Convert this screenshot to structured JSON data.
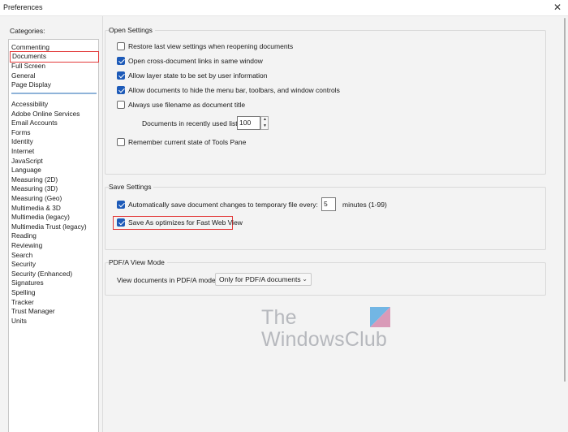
{
  "window": {
    "title": "Preferences",
    "close_glyph": "✕"
  },
  "categories": {
    "label": "Categories:",
    "top": [
      "Commenting",
      "Documents",
      "Full Screen",
      "General",
      "Page Display"
    ],
    "bottom": [
      "Accessibility",
      "Adobe Online Services",
      "Email Accounts",
      "Forms",
      "Identity",
      "Internet",
      "JavaScript",
      "Language",
      "Measuring (2D)",
      "Measuring (3D)",
      "Measuring (Geo)",
      "Multimedia & 3D",
      "Multimedia (legacy)",
      "Multimedia Trust (legacy)",
      "Reading",
      "Reviewing",
      "Search",
      "Security",
      "Security (Enhanced)",
      "Signatures",
      "Spelling",
      "Tracker",
      "Trust Manager",
      "Units"
    ],
    "selected": "Documents"
  },
  "open_settings": {
    "title": "Open Settings",
    "restore_last_view": {
      "label": "Restore last view settings when reopening documents",
      "checked": false
    },
    "cross_doc_links": {
      "label": "Open cross-document links in same window",
      "checked": true
    },
    "layer_state": {
      "label": "Allow layer state to be set by user information",
      "checked": true
    },
    "hide_menu_bar": {
      "label": "Allow documents to hide the menu bar, toolbars, and window controls",
      "checked": true
    },
    "filename_title": {
      "label": "Always use filename as document title",
      "checked": false
    },
    "recent_list": {
      "label": "Documents in recently used list:",
      "value": "100"
    },
    "remember_tools_pane": {
      "label": "Remember current state of Tools Pane",
      "checked": false
    }
  },
  "save_settings": {
    "title": "Save Settings",
    "autosave": {
      "label": "Automatically save document changes to temporary file every:",
      "checked": true,
      "value": "5",
      "unit": "minutes (1-99)"
    },
    "fast_web_view": {
      "label": "Save As optimizes for Fast Web View",
      "checked": true
    }
  },
  "pdfa": {
    "title": "PDF/A View Mode",
    "label": "View documents in PDF/A mode:",
    "selected": "Only for PDF/A documents"
  },
  "watermark": {
    "line1": "The",
    "line2": "WindowsClub"
  },
  "colors": {
    "accent": "#1d5ab8",
    "highlight": "#e23a3a",
    "selection_bar": "#8fb3d9",
    "background": "#f3f3f3"
  }
}
